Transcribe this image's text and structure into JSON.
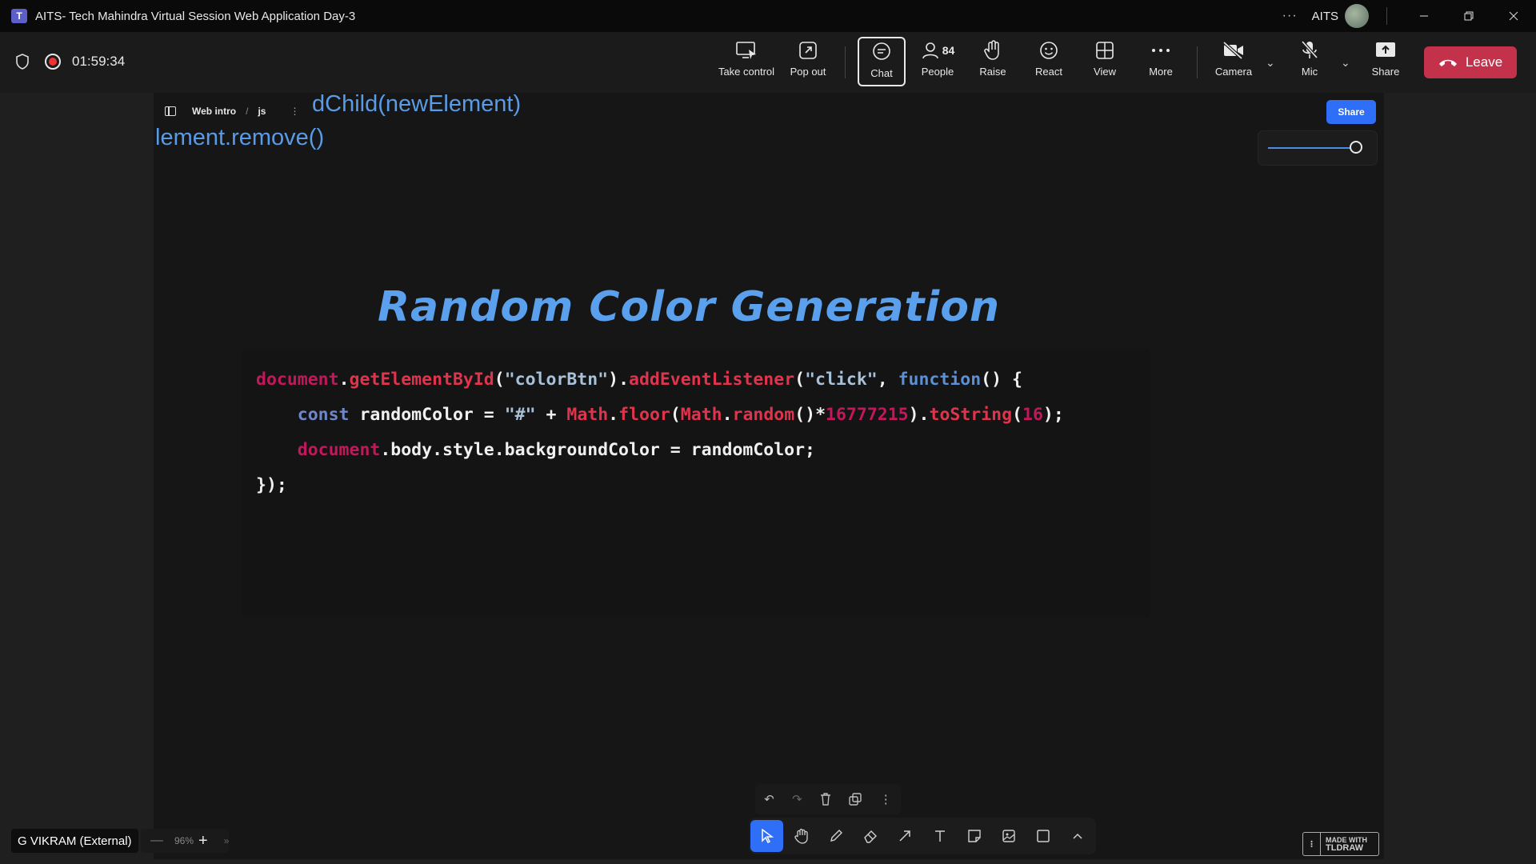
{
  "window": {
    "title": "AITS- Tech Mahindra Virtual Session Web Application Day-3",
    "org": "AITS",
    "overflow": "···"
  },
  "meeting": {
    "timer": "01:59:34",
    "buttons": {
      "take_control": "Take control",
      "pop_out": "Pop out",
      "chat": "Chat",
      "people": "People",
      "people_count": "84",
      "raise": "Raise",
      "react": "React",
      "view": "View",
      "more": "More",
      "camera": "Camera",
      "mic": "Mic",
      "share": "Share",
      "leave": "Leave"
    },
    "participant_name": "G VIKRAM (External)"
  },
  "board": {
    "breadcrumb": [
      "Web intro",
      "js"
    ],
    "share_button": "Share",
    "code_fragment_1": "dChild(newElement)",
    "code_fragment_2": "lement.remove()",
    "slide_title": "Random Color Generation",
    "code": {
      "l1": {
        "a": "document",
        "b": ".",
        "c": "getElementById",
        "d": "(",
        "e": "\"colorBtn\"",
        "f": ").",
        "g": "addEventListener",
        "h": "(",
        "i": "\"click\"",
        "j": ", ",
        "k": "function",
        "l": "() {"
      },
      "l2": {
        "a": "    ",
        "b": "const",
        "c": " randomColor = ",
        "d": "\"#\"",
        "e": " + ",
        "f": "Math",
        "g": ".",
        "h": "floor",
        "i": "(",
        "j": "Math",
        "k": ".",
        "l": "random",
        "m": "()*",
        "n": "16777215",
        "o": ").",
        "p": "toString",
        "q": "(",
        "r": "16",
        "s": ");"
      },
      "l3": {
        "a": "    ",
        "b": "document",
        "c": ".body.style.backgroundColor = randomColor;"
      },
      "l4": "});"
    },
    "zoom_level": "96%",
    "tldraw_badge": [
      "MADE WITH",
      "TLDRAW"
    ]
  },
  "colors": {
    "accent": "#2f6ef7",
    "leave": "#c4314b",
    "title_blue": "#5aa0ec",
    "code_keyword": "#c2185b"
  }
}
